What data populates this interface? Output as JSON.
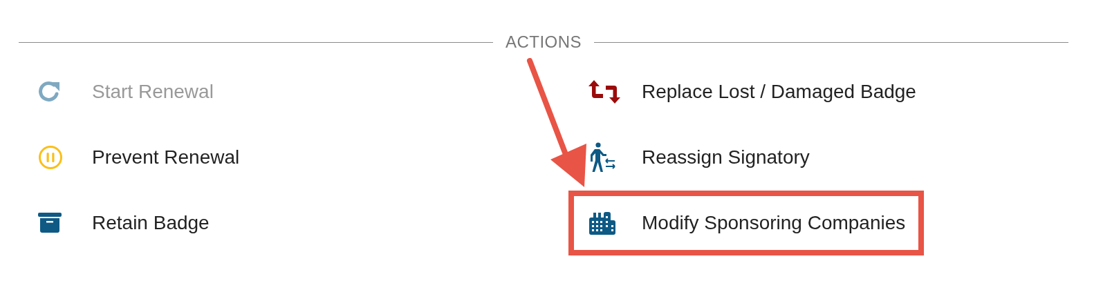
{
  "section": {
    "heading": "ACTIONS"
  },
  "actions": [
    {
      "label": "Start Renewal",
      "kind": "renew",
      "disabled": true,
      "highlighted": false
    },
    {
      "label": "Prevent Renewal",
      "kind": "pause",
      "disabled": false,
      "highlighted": false
    },
    {
      "label": "Retain Badge",
      "kind": "archive",
      "disabled": false,
      "highlighted": false
    },
    {
      "label": "Replace Lost / Damaged Badge",
      "kind": "replace",
      "disabled": false,
      "highlighted": false
    },
    {
      "label": "Reassign Signatory",
      "kind": "reassign",
      "disabled": false,
      "highlighted": false
    },
    {
      "label": "Modify Sponsoring Companies",
      "kind": "companies",
      "disabled": false,
      "highlighted": true
    }
  ]
}
